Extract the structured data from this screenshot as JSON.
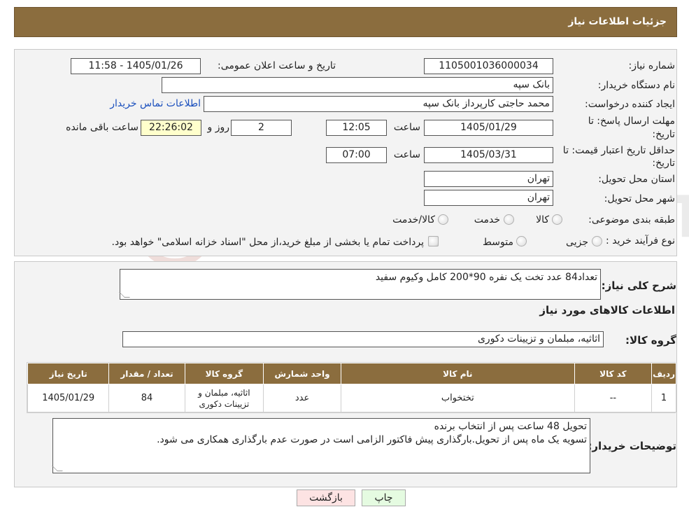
{
  "header": {
    "title": "جزئیات اطلاعات نیاز"
  },
  "watermark": {
    "text": "AriaTender.neT"
  },
  "form": {
    "need_number_label": "شماره نیاز:",
    "need_number": "1105001036000034",
    "announce_label": "تاریخ و ساعت اعلان عمومی:",
    "announce_value": "1405/01/26 - 11:58",
    "buyer_org_label": "نام دستگاه خریدار:",
    "buyer_org": "بانک سپه",
    "creator_label": "ایجاد کننده درخواست:",
    "creator": "محمد حاجتی کارپرداز بانک سپه",
    "contact_link": "اطلاعات تماس خریدار",
    "deadline_label_1": "مهلت ارسال پاسخ: تا",
    "deadline_label_2": "تاریخ:",
    "deadline_date": "1405/01/29",
    "time_label": "ساعت",
    "deadline_time": "12:05",
    "days": "2",
    "days_label": "روز و",
    "remaining": "22:26:02",
    "remaining_label": "ساعت باقی مانده",
    "validity_label_1": "حداقل تاریخ اعتبار قیمت: تا",
    "validity_label_2": "تاریخ:",
    "validity_date": "1405/03/31",
    "validity_time": "07:00",
    "province_label": "استان محل تحویل:",
    "province": "تهران",
    "city_label": "شهر محل تحویل:",
    "city": "تهران",
    "category_label": "طبقه بندی موضوعی:",
    "category_options": [
      "کالا",
      "خدمت",
      "کالا/خدمت"
    ],
    "process_label": "نوع فرآیند خرید :",
    "process_options": [
      "جزیی",
      "متوسط"
    ],
    "process_note": "پرداخت تمام یا بخشی از مبلغ خرید،از محل \"اسناد خزانه اسلامی\" خواهد بود."
  },
  "details": {
    "summary_label": "شرح کلی نیاز:",
    "summary": "تعداد84 عدد تخت یک نفره 90*200 کامل وکیوم سفید",
    "goods_title": "اطلاعات کالاهای مورد نیاز",
    "group_label": "گروه کالا:",
    "group_value": "اثاثیه، مبلمان و تزیینات دکوری"
  },
  "table": {
    "headers": [
      "ردیف",
      "کد کالا",
      "نام کالا",
      "واحد شمارش",
      "گروه کالا",
      "تعداد / مقدار",
      "تاریخ نیاز"
    ],
    "rows": [
      [
        "1",
        "--",
        "تختخواب",
        "عدد",
        "اثاثیه، مبلمان و تزیینات دکوری",
        "84",
        "1405/01/29"
      ]
    ]
  },
  "buyer_notes": {
    "label": "توضیحات خریدار:",
    "line1": "تحویل 48 ساعت پس از انتخاب برنده",
    "line2": "تسویه یک ماه پس از تحویل.بارگذاری پیش فاکتور الزامی است در صورت عدم بارگذاری همکاری می شود."
  },
  "buttons": {
    "print": "چاپ",
    "back": "بازگشت"
  },
  "colors": {
    "header": "#8b6d3e",
    "link": "#1a4fbd",
    "remaining_bg": "#ffffcc",
    "back_button": "#fde3e3",
    "print_button": "#e5fbe1"
  }
}
